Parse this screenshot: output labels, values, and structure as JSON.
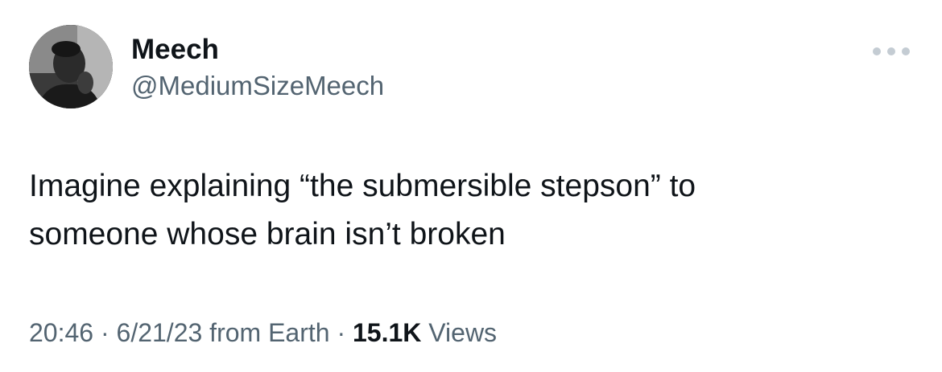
{
  "author": {
    "display_name": "Meech",
    "handle": "@MediumSizeMeech",
    "avatar_icon": "profile-photo"
  },
  "more_icon": "more-horizontal-icon",
  "tweet": {
    "lines": [
      "Imagine explaining “the submersible stepson” to",
      "someone whose brain isn’t broken"
    ]
  },
  "meta": {
    "time": "20:46",
    "separator1": " · ",
    "date": "6/21/23",
    "source": " from Earth",
    "separator2": " · ",
    "views_count": "15.1K",
    "views_label": " Views"
  },
  "colors": {
    "text": "#0f1419",
    "secondary": "#536471",
    "dots": "#c4ccd3"
  }
}
